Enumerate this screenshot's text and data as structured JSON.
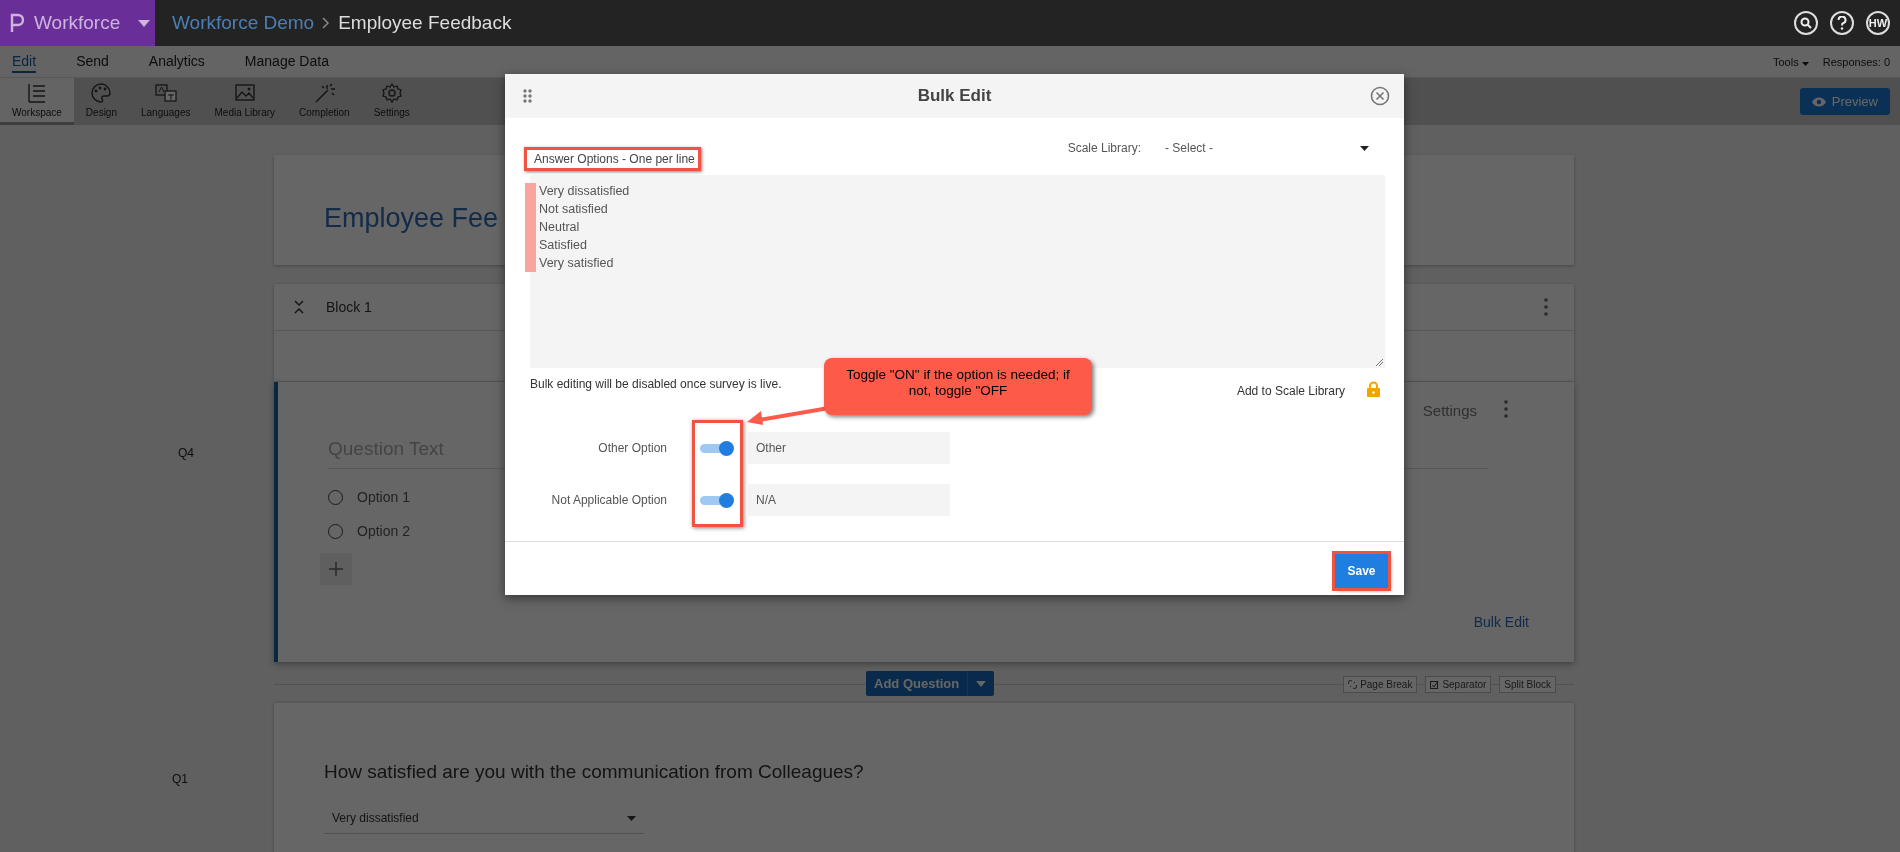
{
  "app": {
    "product": "Workforce",
    "breadcrumb": [
      {
        "label": "Workforce Demo"
      },
      {
        "label": "Employee Feedback"
      }
    ],
    "avatar": "HW"
  },
  "menu": {
    "items": [
      {
        "label": "Edit",
        "selected": true
      },
      {
        "label": "Send",
        "selected": false
      },
      {
        "label": "Analytics",
        "selected": false
      },
      {
        "label": "Manage Data",
        "selected": false
      }
    ],
    "tools": "Tools",
    "responses": "Responses: 0"
  },
  "toolbar": {
    "items": [
      {
        "label": "Workspace",
        "selected": true
      },
      {
        "label": "Design",
        "selected": false
      },
      {
        "label": "Languages",
        "selected": false
      },
      {
        "label": "Media Library",
        "selected": false
      },
      {
        "label": "Completion",
        "selected": false
      },
      {
        "label": "Settings",
        "selected": false
      }
    ],
    "preview": "Preview"
  },
  "survey": {
    "title": "Employee Fee",
    "block": "Block 1",
    "question": {
      "number": "Q4",
      "placeholder": "Question Text",
      "options": [
        {
          "label": "Option 1",
          "selected": false
        },
        {
          "label": "Option 2",
          "selected": false
        }
      ],
      "settings": "Settings",
      "bulk_edit": "Bulk Edit"
    },
    "add_question": "Add Question",
    "block_actions": [
      "Page Break",
      "Separator",
      "Split Block"
    ],
    "next_question": {
      "number": "Q1",
      "text": "How satisfied are you with the communication from Colleagues?",
      "answer": "Very dissatisfied"
    }
  },
  "modal": {
    "title": "Bulk Edit",
    "answer_label": "Answer Options - One per line",
    "answer_label_highlighted": true,
    "scale_library_label": "Scale Library:",
    "scale_select": "- Select -",
    "answer_options": [
      "Very dissatisfied",
      "Not satisfied",
      "Neutral",
      "Satisfied",
      "Very satisfied"
    ],
    "answer_options_highlighted": true,
    "note": "Bulk editing will be disabled once survey is live.",
    "add_to_library": "Add to Scale Library",
    "library_locked": true,
    "extra_options": [
      {
        "label": "Other Option",
        "on": true,
        "value": "Other"
      },
      {
        "label": "Not Applicable Option",
        "on": true,
        "value": "N/A"
      }
    ],
    "toggles_highlighted": true,
    "save": "Save",
    "save_highlighted": true,
    "callout": "Toggle \"ON\" if the option is needed; if not, toggle \"OFF"
  }
}
